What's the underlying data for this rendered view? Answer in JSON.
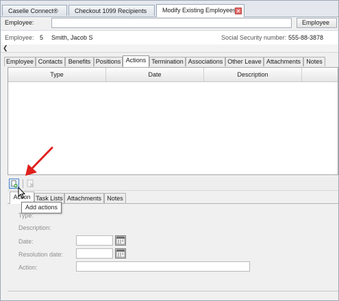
{
  "doc_tabs": [
    {
      "label": "Caselle Connect®"
    },
    {
      "label": "Checkout 1099 Recipients"
    },
    {
      "label": "Modify Existing Employees"
    }
  ],
  "employee_bar": {
    "label": "Employee:",
    "input_value": "",
    "button_label": "Employee"
  },
  "info": {
    "employee_label": "Employee:",
    "employee_number": "5",
    "employee_name": "Smith, Jacob S",
    "ssn_label": "Social Security number:",
    "ssn_value": "555-88-3878"
  },
  "section_tabs": [
    "Employee",
    "Contacts",
    "Benefits",
    "Positions",
    "Actions",
    "Termination",
    "Associations",
    "Other Leave",
    "Attachments",
    "Notes"
  ],
  "active_section_tab": "Actions",
  "grid": {
    "columns": [
      "Type",
      "Date",
      "Description"
    ]
  },
  "toolbar": {
    "tooltip": "Add actions"
  },
  "sub_tabs": [
    "Action",
    "Task Lists",
    "Attachments",
    "Notes"
  ],
  "active_sub_tab": "Action",
  "form": {
    "type_label": "Type:",
    "description_label": "Description:",
    "date_label": "Date:",
    "resolution_date_label": "Resolution date:",
    "action_label": "Action:",
    "date_value": "",
    "resolution_date_value": "",
    "action_value": ""
  },
  "colors": {
    "arrow": "#e0201c",
    "add_button": "#4f86c6",
    "frame": "#9aa6b4"
  },
  "icons": [
    "close-icon",
    "chevron-left-icon",
    "add-action-icon",
    "delete-action-icon",
    "calendar-icon",
    "cursor-icon",
    "red-arrow-annotation"
  ]
}
